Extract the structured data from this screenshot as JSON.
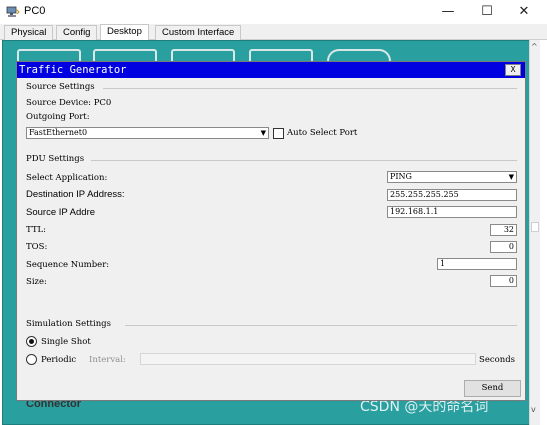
{
  "window": {
    "title": "PC0",
    "min_glyph": "—",
    "max_glyph": "☐",
    "close_glyph": "✕"
  },
  "tabs": [
    {
      "label": "Physical",
      "active": false
    },
    {
      "label": "Config",
      "active": false
    },
    {
      "label": "Desktop",
      "active": true
    },
    {
      "label": "Custom Interface",
      "active": false
    }
  ],
  "desktop": {
    "bottom_text": "Connector",
    "watermark": "CSDN @天的命名词",
    "scroll_up": "^",
    "scroll_down": "v"
  },
  "dialog": {
    "title": "Traffic Generator",
    "close_label": "X",
    "source_settings": {
      "heading": "Source Settings",
      "source_device_label": "Source Device: PC0",
      "outgoing_port_label": "Outgoing Port:",
      "outgoing_port_value": "FastEthernet0",
      "auto_select_label": "Auto Select Port",
      "auto_select_checked": false
    },
    "pdu_settings": {
      "heading": "PDU Settings",
      "select_application_label": "Select Application:",
      "select_application_value": "PING",
      "destination_ip_label": "Destination IP Address:",
      "destination_ip_value": "255.255.255.255",
      "source_ip_label": "Source IP Addre",
      "source_ip_value": "192.168.1.1",
      "ttl_label": "TTL:",
      "ttl_value": "32",
      "tos_label": "TOS:",
      "tos_value": "0",
      "sequence_label": "Sequence Number:",
      "sequence_value": "1",
      "size_label": "Size:",
      "size_value": "0"
    },
    "simulation_settings": {
      "heading": "Simulation Settings",
      "single_shot_label": "Single Shot",
      "single_shot_selected": true,
      "periodic_label": "Periodic",
      "interval_label": "Interval:",
      "seconds_label": "Seconds"
    },
    "send_label": "Send"
  },
  "colors": {
    "titlebar_blue": "#0000e0",
    "desktop_teal": "#2a9f9f"
  }
}
